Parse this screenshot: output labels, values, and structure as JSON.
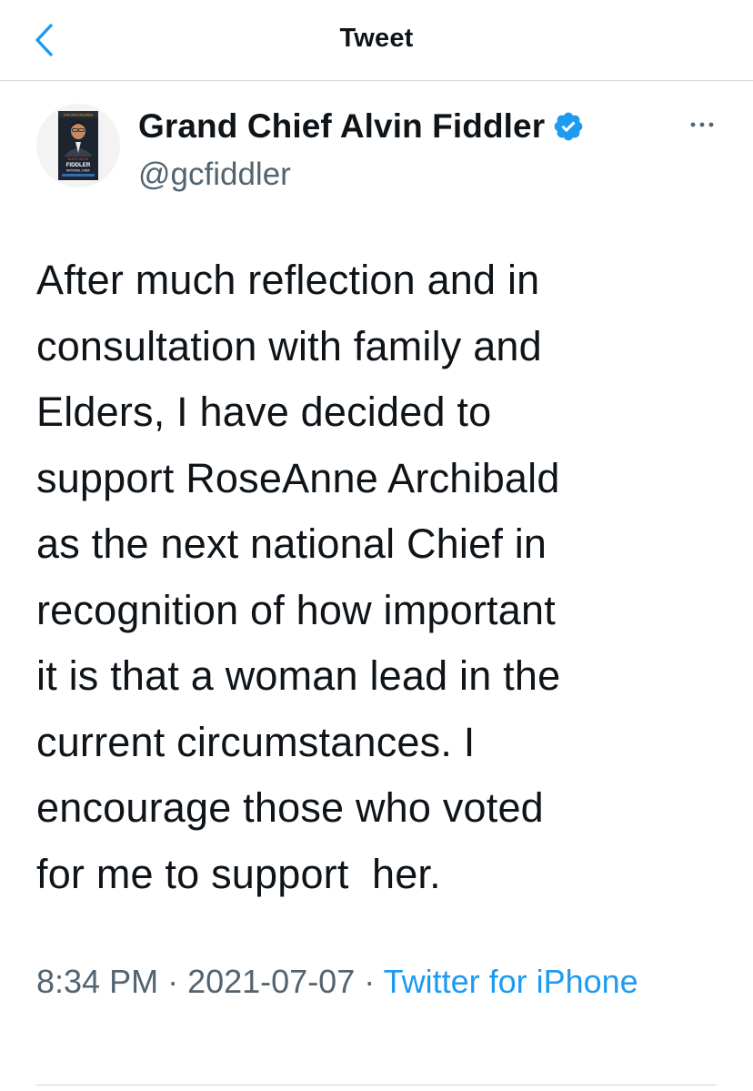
{
  "nav": {
    "title": "Tweet",
    "back_icon": "chevron-left-icon"
  },
  "author": {
    "display_name": "Grand Chief Alvin Fiddler",
    "handle": "@gcfiddler",
    "verified": true,
    "avatar_text": {
      "top": "FOR OUR CHILDREN",
      "line1": "ELECT ALVIN",
      "line2": "FIDDLER",
      "line3": "NATIONAL CHIEF"
    },
    "more_icon": "ellipsis-icon"
  },
  "tweet": {
    "text": "After much reflection and in\nconsultation with family and\nElders, I have decided to\nsupport RoseAnne Archibald\nas the next national Chief in\nrecognition of how important\nit is that a woman lead in the\ncurrent circumstances. I\nencourage those who voted\nfor me to support  her."
  },
  "meta": {
    "time": "8:34 PM",
    "separator": " · ",
    "date": "2021-07-07",
    "source": "Twitter for iPhone"
  },
  "colors": {
    "accent": "#1d9bf0",
    "text": "#0f1419",
    "secondary": "#536471",
    "divider": "#cfd9de"
  }
}
